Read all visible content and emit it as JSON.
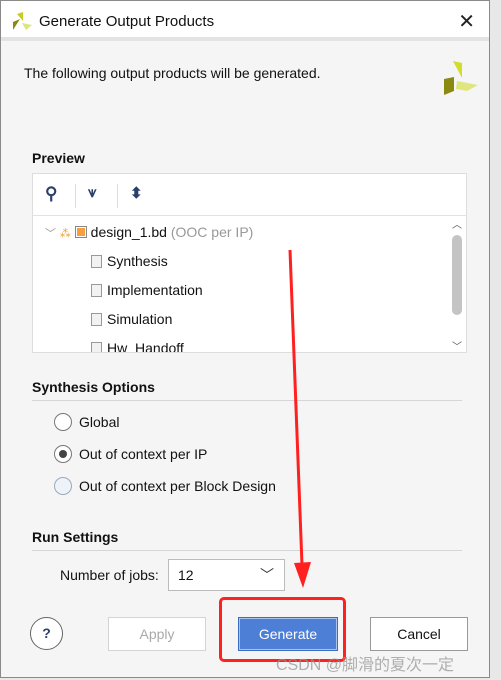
{
  "window": {
    "title": "Generate Output Products",
    "close_icon": "close-icon"
  },
  "description": "The following output products will be generated.",
  "preview": {
    "label": "Preview",
    "toolbar": [
      "search-icon",
      "collapse-all-icon",
      "expand-all-icon"
    ],
    "tree": {
      "root": "design_1.bd",
      "root_note": "(OOC per IP)",
      "children": [
        "Synthesis",
        "Implementation",
        "Simulation",
        "Hw_Handoff"
      ]
    }
  },
  "synthesis_options": {
    "label": "Synthesis Options",
    "options": [
      {
        "label": "Global",
        "selected": false
      },
      {
        "label": "Out of context per IP",
        "selected": true
      },
      {
        "label": "Out of context per Block Design",
        "selected": false
      }
    ]
  },
  "run_settings": {
    "label": "Run Settings",
    "jobs_label": "Number of jobs:",
    "jobs_value": "12"
  },
  "buttons": {
    "help": "?",
    "apply": "Apply",
    "generate": "Generate",
    "cancel": "Cancel"
  },
  "watermark": "CSDN @脚滑的夏次一定",
  "colors": {
    "accent": "#4d7fd6",
    "annotation": "#ff2020"
  }
}
